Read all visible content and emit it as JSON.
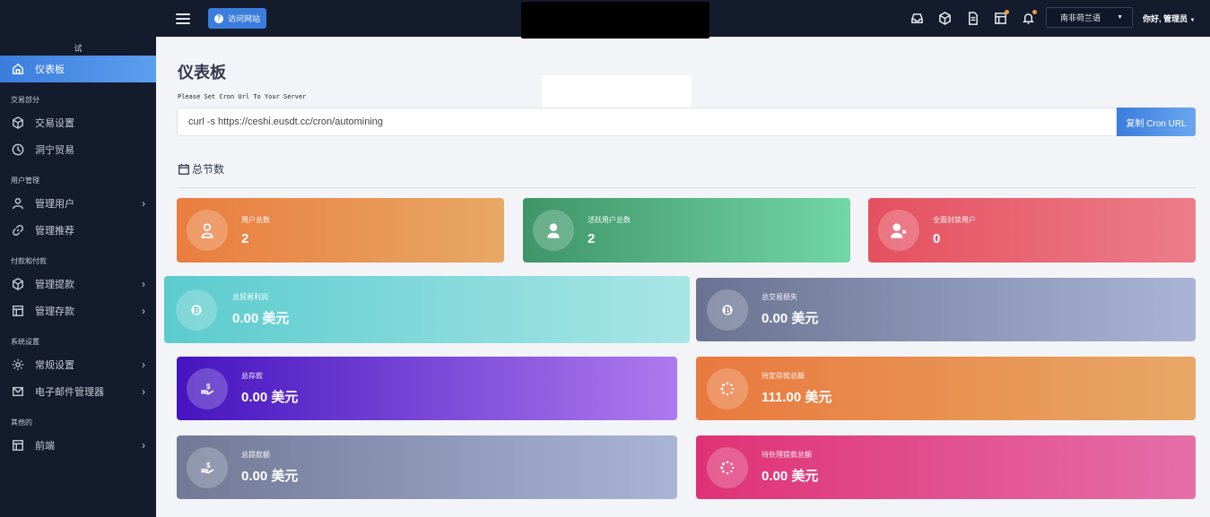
{
  "sidebar": {
    "brand": "试",
    "items": [
      {
        "label": "仪表板",
        "icon": "home-icon"
      },
      {
        "section": "交易部分"
      },
      {
        "label": "交易设置",
        "icon": "cube-icon"
      },
      {
        "label": "洞宁贸易",
        "icon": "clock-icon"
      },
      {
        "section": "用户管理"
      },
      {
        "label": "管理用户",
        "icon": "user-icon"
      },
      {
        "label": "管理推荐",
        "icon": "link-icon"
      },
      {
        "section": "付款和付款"
      },
      {
        "label": "管理提款",
        "icon": "cube-icon"
      },
      {
        "label": "管理存款",
        "icon": "table-icon"
      },
      {
        "section": "系统设置"
      },
      {
        "label": "常规设置",
        "icon": "gear-icon"
      },
      {
        "label": "电子邮件管理器",
        "icon": "mail-icon"
      },
      {
        "section": "其他的"
      },
      {
        "label": "前端",
        "icon": "layout-icon"
      }
    ]
  },
  "topbar": {
    "visit_label": "访问网站",
    "language": "南非荷兰语",
    "user_greeting": "你好, 管理员"
  },
  "main": {
    "title": "仪表板",
    "cron_note": "Please Set Cron Url To Your Server",
    "cron_url": "curl -s https://ceshi.eusdt.cc/cron/automining",
    "copy_label": "复制 Cron URL",
    "stats_title": "总节数"
  },
  "cards": [
    {
      "label": "用户总数",
      "value": "2",
      "icon": "user-icon",
      "color": "#e8803f"
    },
    {
      "label": "活跃用户总数",
      "value": "2",
      "icon": "user-tie-icon",
      "color": "#3f9a6a"
    },
    {
      "label": "全面封禁用户",
      "value": "0",
      "icon": "user-x-icon",
      "color": "#e6505e"
    },
    {
      "label": "总贸易利润",
      "value": "0.00 美元",
      "icon": "bitcoin-icon",
      "color": "#5ccdd0"
    },
    {
      "label": "总交易损失",
      "value": "0.00 美元",
      "icon": "bitcoin-icon",
      "color": "#6c7592"
    },
    {
      "label": "总存款",
      "value": "0.00 美元",
      "icon": "hand-dollar-icon",
      "color": "#4a16c0"
    },
    {
      "label": "待定存款总额",
      "value": "111.00 美元",
      "icon": "spinner-icon",
      "color": "#e8803f"
    },
    {
      "label": "总提款额",
      "value": "0.00 美元",
      "icon": "hand-dollar-icon",
      "color": "#737b98"
    },
    {
      "label": "待处理提款总额",
      "value": "0.00 美元",
      "icon": "spinner-icon",
      "color": "#df357a"
    }
  ]
}
